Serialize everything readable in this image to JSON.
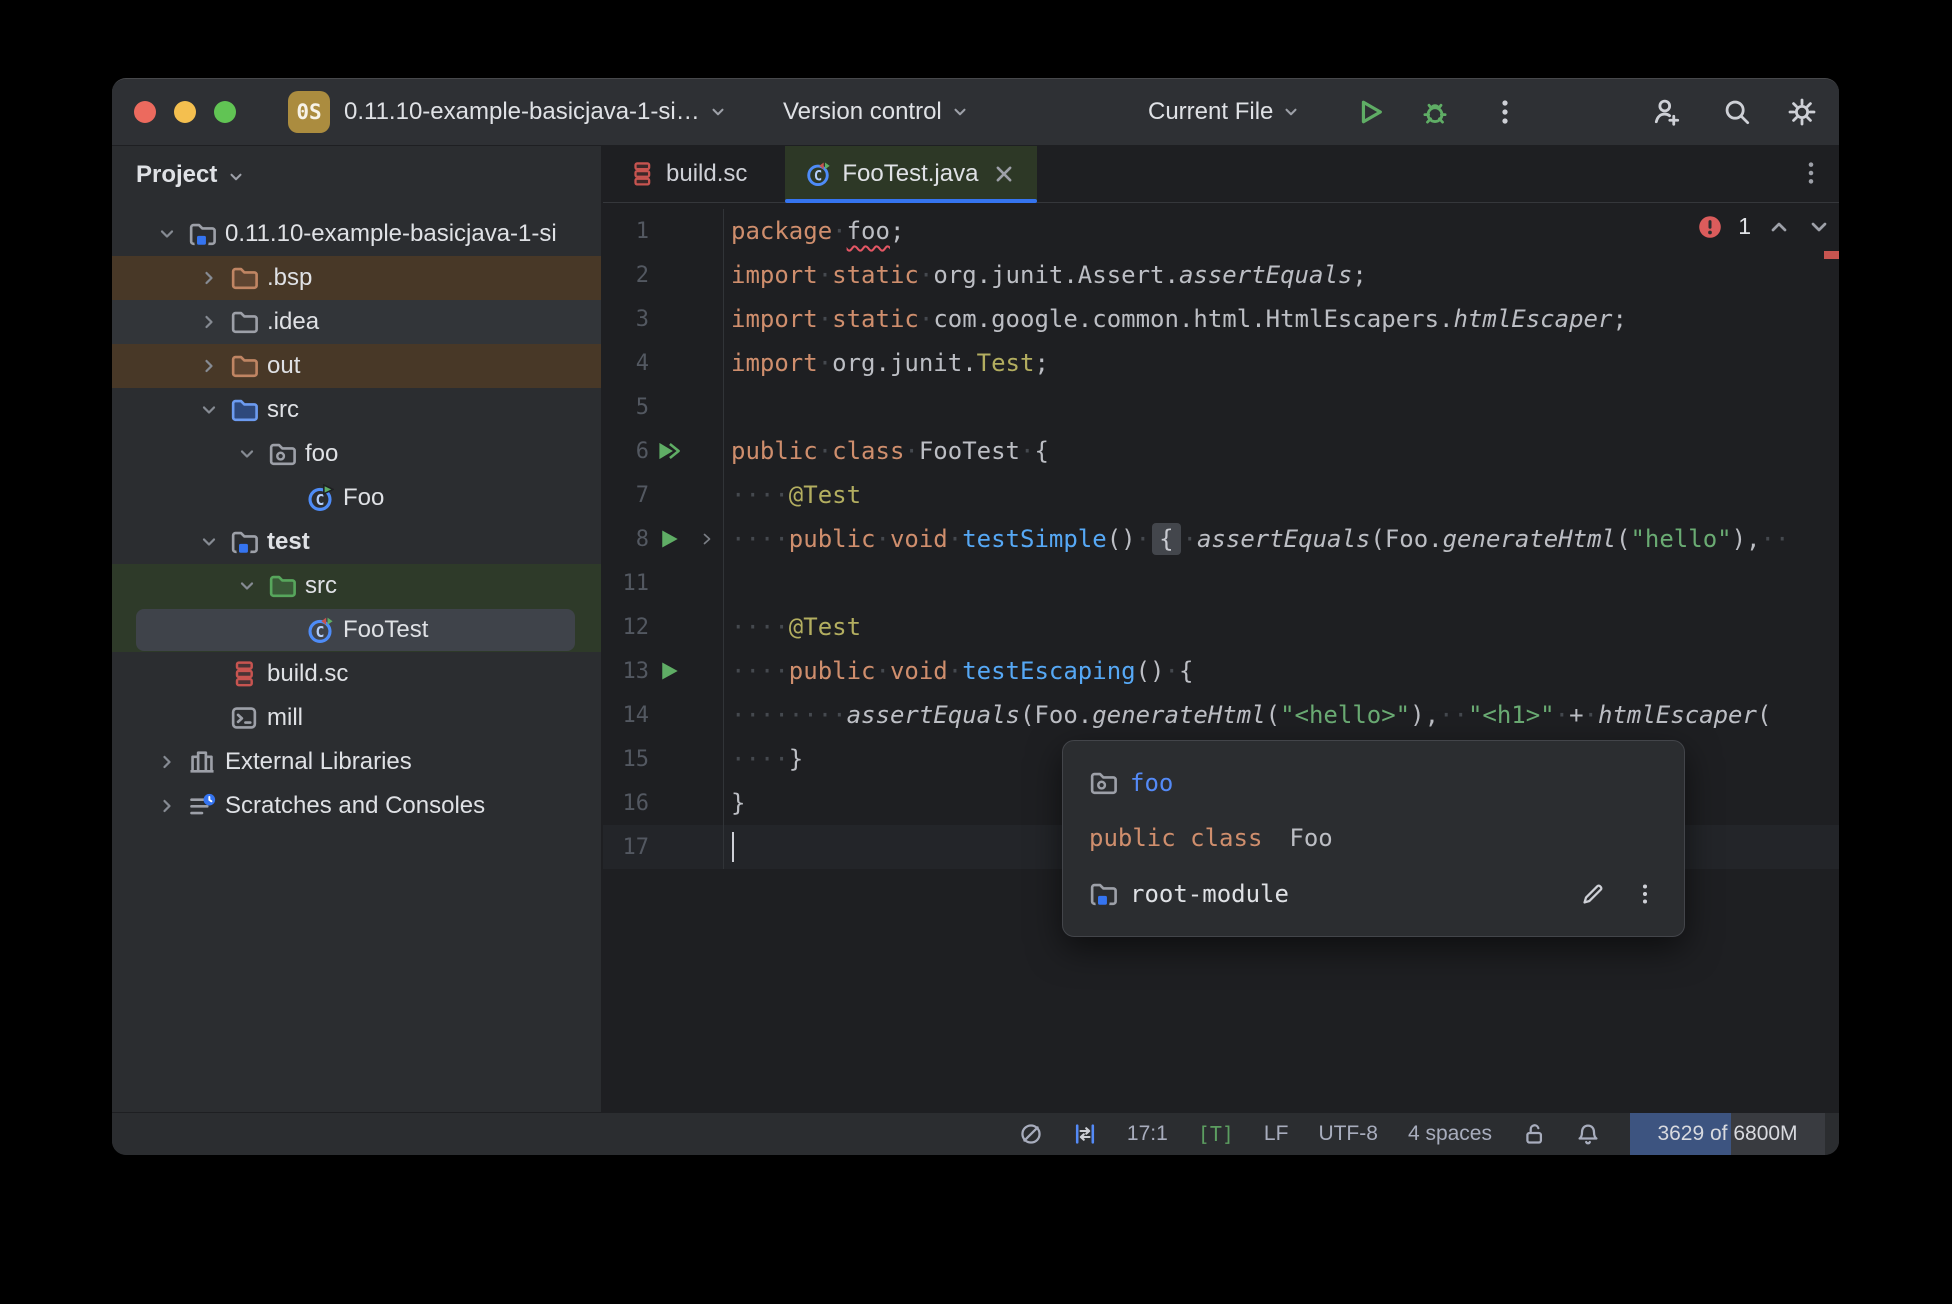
{
  "colors": {
    "accent_blue": "#3574F0",
    "run_green": "#5FAD65",
    "error_red": "#DB5C5C",
    "keyword_orange": "#CF8E6D",
    "string_green": "#6AAB73",
    "annotation_yellow": "#B3AE60",
    "method_blue": "#56A8F5",
    "excluded_brown": "#483827",
    "test_scope_green": "#2E3A29",
    "editor_bg": "#1E1F22",
    "panel_bg": "#2B2D30"
  },
  "titlebar": {
    "badge": "0S",
    "project_name": "0.11.10-example-basicjava-1-si…",
    "version_control": "Version control",
    "run_config": "Current File",
    "icons": [
      "run-icon",
      "debug-icon",
      "more-icon",
      "code-with-me-icon",
      "search-icon",
      "settings-icon"
    ]
  },
  "project_panel": {
    "header": "Project",
    "tree": [
      {
        "label": "0.11.10-example-basicjava-1-si",
        "level": 1,
        "chevron": "down",
        "icon": "module-folder-icon"
      },
      {
        "label": ".bsp",
        "level": 2,
        "chevron": "right",
        "icon": "excluded-folder-icon",
        "highlight": "excluded"
      },
      {
        "label": ".idea",
        "level": 2,
        "chevron": "right",
        "icon": "plain-folder-icon",
        "highlight": "hover"
      },
      {
        "label": "out",
        "level": 2,
        "chevron": "right",
        "icon": "excluded-folder-icon",
        "highlight": "excluded"
      },
      {
        "label": "src",
        "level": 2,
        "chevron": "down",
        "icon": "sources-folder-icon"
      },
      {
        "label": "foo",
        "level": 3,
        "chevron": "down",
        "icon": "package-icon"
      },
      {
        "label": "Foo",
        "level": 4,
        "chevron": null,
        "icon": "run-class-icon"
      },
      {
        "label": "test",
        "level": 2,
        "chevron": "down",
        "icon": "module-folder-icon",
        "bold": true
      },
      {
        "label": "src",
        "level": 3,
        "chevron": "down",
        "icon": "test-folder-icon",
        "highlight": "scope-green"
      },
      {
        "label": "FooTest",
        "level": 4,
        "chevron": null,
        "icon": "test-class-icon",
        "highlight": "scope-green",
        "selected": true
      },
      {
        "label": "build.sc",
        "level": 2,
        "chevron": null,
        "icon": "scala-file-icon"
      },
      {
        "label": "mill",
        "level": 2,
        "chevron": null,
        "icon": "terminal-file-icon"
      },
      {
        "label": "External Libraries",
        "level": 1,
        "chevron": "right",
        "icon": "libraries-icon"
      },
      {
        "label": "Scratches and Consoles",
        "level": 1,
        "chevron": "right",
        "icon": "scratches-icon"
      }
    ]
  },
  "tabs": [
    {
      "label": "build.sc",
      "icon": "scala-file-icon",
      "active": false,
      "closable": false
    },
    {
      "label": "FooTest.java",
      "icon": "test-class-icon",
      "active": true,
      "closable": true
    }
  ],
  "editor": {
    "error_count": "1",
    "lines": [
      {
        "num": "1",
        "gutter": null,
        "fold": false,
        "segs": [
          [
            "kw",
            "package"
          ],
          [
            "ws",
            "·"
          ],
          [
            "err",
            "foo"
          ],
          [
            "txt",
            ";"
          ]
        ]
      },
      {
        "num": "2",
        "gutter": null,
        "fold": false,
        "segs": [
          [
            "kw",
            "import"
          ],
          [
            "ws",
            "·"
          ],
          [
            "kw",
            "static"
          ],
          [
            "ws",
            "·"
          ],
          [
            "txt",
            "org.junit.Assert."
          ],
          [
            "itl",
            "assertEquals"
          ],
          [
            "txt",
            ";"
          ]
        ]
      },
      {
        "num": "3",
        "gutter": null,
        "fold": false,
        "segs": [
          [
            "kw",
            "import"
          ],
          [
            "ws",
            "·"
          ],
          [
            "kw",
            "static"
          ],
          [
            "ws",
            "·"
          ],
          [
            "txt",
            "com.google.common.html.HtmlEscapers."
          ],
          [
            "itl",
            "htmlEscaper"
          ],
          [
            "txt",
            ";"
          ]
        ]
      },
      {
        "num": "4",
        "gutter": null,
        "fold": false,
        "segs": [
          [
            "kw",
            "import"
          ],
          [
            "ws",
            "·"
          ],
          [
            "txt",
            "org.junit."
          ],
          [
            "ann",
            "Test"
          ],
          [
            "txt",
            ";"
          ]
        ]
      },
      {
        "num": "5",
        "gutter": null,
        "fold": false,
        "segs": []
      },
      {
        "num": "6",
        "gutter": "run-all",
        "fold": false,
        "segs": [
          [
            "kw",
            "public"
          ],
          [
            "ws",
            "·"
          ],
          [
            "kw",
            "class"
          ],
          [
            "ws",
            "·"
          ],
          [
            "txt",
            "FooTest"
          ],
          [
            "ws",
            "·"
          ],
          [
            "txt",
            "{"
          ]
        ]
      },
      {
        "num": "7",
        "gutter": null,
        "fold": false,
        "segs": [
          [
            "ws",
            "····"
          ],
          [
            "ann",
            "@Test"
          ]
        ]
      },
      {
        "num": "8",
        "gutter": "run",
        "fold": true,
        "segs": [
          [
            "ws",
            "····"
          ],
          [
            "kw",
            "public"
          ],
          [
            "ws",
            "·"
          ],
          [
            "kw",
            "void"
          ],
          [
            "ws",
            "·"
          ],
          [
            "mth",
            "testSimple"
          ],
          [
            "txt",
            "()"
          ],
          [
            "ws",
            "·"
          ],
          [
            "fold",
            "{"
          ],
          [
            "ws",
            "·"
          ],
          [
            "itl",
            "assertEquals"
          ],
          [
            "txt",
            "("
          ],
          [
            "txt",
            "Foo."
          ],
          [
            "itl",
            "generateHtml"
          ],
          [
            "txt",
            "("
          ],
          [
            "str",
            "\"hello\""
          ],
          [
            "txt",
            "),"
          ],
          [
            "ws",
            "··"
          ]
        ]
      },
      {
        "num": "11",
        "gutter": null,
        "fold": false,
        "segs": []
      },
      {
        "num": "12",
        "gutter": null,
        "fold": false,
        "segs": [
          [
            "ws",
            "····"
          ],
          [
            "ann",
            "@Test"
          ]
        ]
      },
      {
        "num": "13",
        "gutter": "run",
        "fold": false,
        "segs": [
          [
            "ws",
            "····"
          ],
          [
            "kw",
            "public"
          ],
          [
            "ws",
            "·"
          ],
          [
            "kw",
            "void"
          ],
          [
            "ws",
            "·"
          ],
          [
            "mth",
            "testEscaping"
          ],
          [
            "txt",
            "()"
          ],
          [
            "ws",
            "·"
          ],
          [
            "txt",
            "{"
          ]
        ]
      },
      {
        "num": "14",
        "gutter": null,
        "fold": false,
        "segs": [
          [
            "ws",
            "········"
          ],
          [
            "itl",
            "assertEquals"
          ],
          [
            "txt",
            "(Foo."
          ],
          [
            "itl",
            "generateHtml"
          ],
          [
            "txt",
            "("
          ],
          [
            "str",
            "\"<hello>\""
          ],
          [
            "txt",
            "),"
          ],
          [
            "ws",
            "··"
          ],
          [
            "str",
            "\"<h1>\""
          ],
          [
            "ws",
            "·"
          ],
          [
            "txt",
            "+"
          ],
          [
            "ws",
            "·"
          ],
          [
            "itl",
            "htmlEscaper"
          ],
          [
            "txt",
            "("
          ]
        ]
      },
      {
        "num": "15",
        "gutter": null,
        "fold": false,
        "segs": [
          [
            "ws",
            "····"
          ],
          [
            "txt",
            "}"
          ]
        ]
      },
      {
        "num": "16",
        "gutter": null,
        "fold": false,
        "segs": [
          [
            "txt",
            "}"
          ]
        ]
      },
      {
        "num": "17",
        "gutter": null,
        "fold": false,
        "caret": true,
        "segs": []
      }
    ]
  },
  "popup": {
    "package_icon": "package-icon",
    "package_name": "foo",
    "sig_keywords": "public class",
    "sig_name": "Foo",
    "module_icon": "module-folder-icon",
    "module_name": "root-module",
    "action_icons": [
      "edit-pencil-icon",
      "more-kebab-icon"
    ]
  },
  "statusbar": {
    "caret_position": "17:1",
    "tag": "[T]",
    "line_separator": "LF",
    "encoding": "UTF-8",
    "indent": "4 spaces",
    "memory": "3629 of 6800M",
    "memory_fill": 0.52,
    "icons": [
      "highlighting-level-icon",
      "column-selection-icon",
      "lock-open-icon",
      "notifications-bell-icon"
    ]
  }
}
